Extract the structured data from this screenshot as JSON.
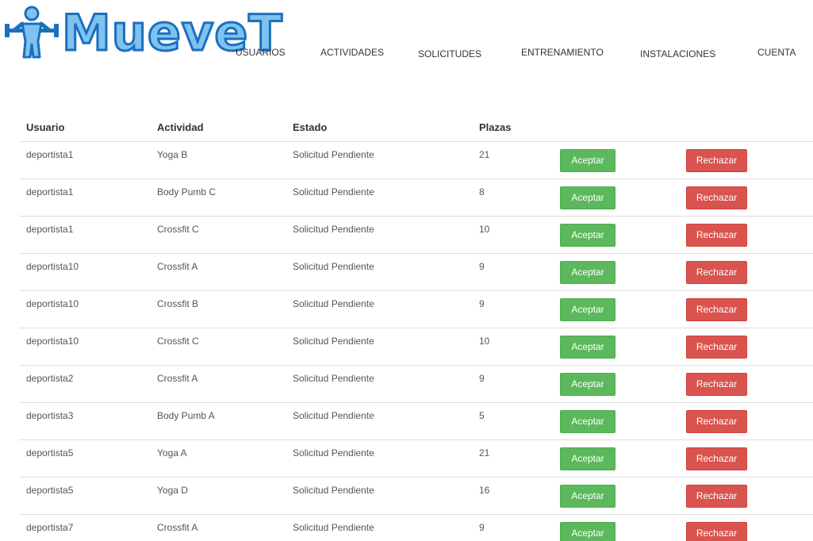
{
  "brand": {
    "name": "MueveT",
    "colors": {
      "fill": "#7ec3ee",
      "outline": "#1a6fbf"
    }
  },
  "nav": [
    {
      "label": "USUARIOS"
    },
    {
      "label": "ACTIVIDADES"
    },
    {
      "label": "SOLICITUDES"
    },
    {
      "label": "ENTRENAMIENTO"
    },
    {
      "label": "INSTALACIONES"
    },
    {
      "label": "CUENTA"
    }
  ],
  "table": {
    "headers": {
      "user": "Usuario",
      "activity": "Actividad",
      "state": "Estado",
      "seats": "Plazas"
    },
    "accept_label": "Aceptar",
    "reject_label": "Rechazar",
    "accept_color": "#5cb85c",
    "reject_color": "#d9534f",
    "rows": [
      {
        "user": "deportista1",
        "activity": "Yoga B",
        "state": "Solicitud Pendiente",
        "seats": "21"
      },
      {
        "user": "deportista1",
        "activity": "Body Pumb C",
        "state": "Solicitud Pendiente",
        "seats": "8"
      },
      {
        "user": "deportista1",
        "activity": "Crossfit C",
        "state": "Solicitud Pendiente",
        "seats": "10"
      },
      {
        "user": "deportista10",
        "activity": "Crossfit A",
        "state": "Solicitud Pendiente",
        "seats": "9"
      },
      {
        "user": "deportista10",
        "activity": "Crossfit B",
        "state": "Solicitud Pendiente",
        "seats": "9"
      },
      {
        "user": "deportista10",
        "activity": "Crossfit C",
        "state": "Solicitud Pendiente",
        "seats": "10"
      },
      {
        "user": "deportista2",
        "activity": "Crossfit A",
        "state": "Solicitud Pendiente",
        "seats": "9"
      },
      {
        "user": "deportista3",
        "activity": "Body Pumb A",
        "state": "Solicitud Pendiente",
        "seats": "5"
      },
      {
        "user": "deportista5",
        "activity": "Yoga A",
        "state": "Solicitud Pendiente",
        "seats": "21"
      },
      {
        "user": "deportista5",
        "activity": "Yoga D",
        "state": "Solicitud Pendiente",
        "seats": "16"
      },
      {
        "user": "deportista7",
        "activity": "Crossfit A",
        "state": "Solicitud Pendiente",
        "seats": "9"
      }
    ]
  }
}
